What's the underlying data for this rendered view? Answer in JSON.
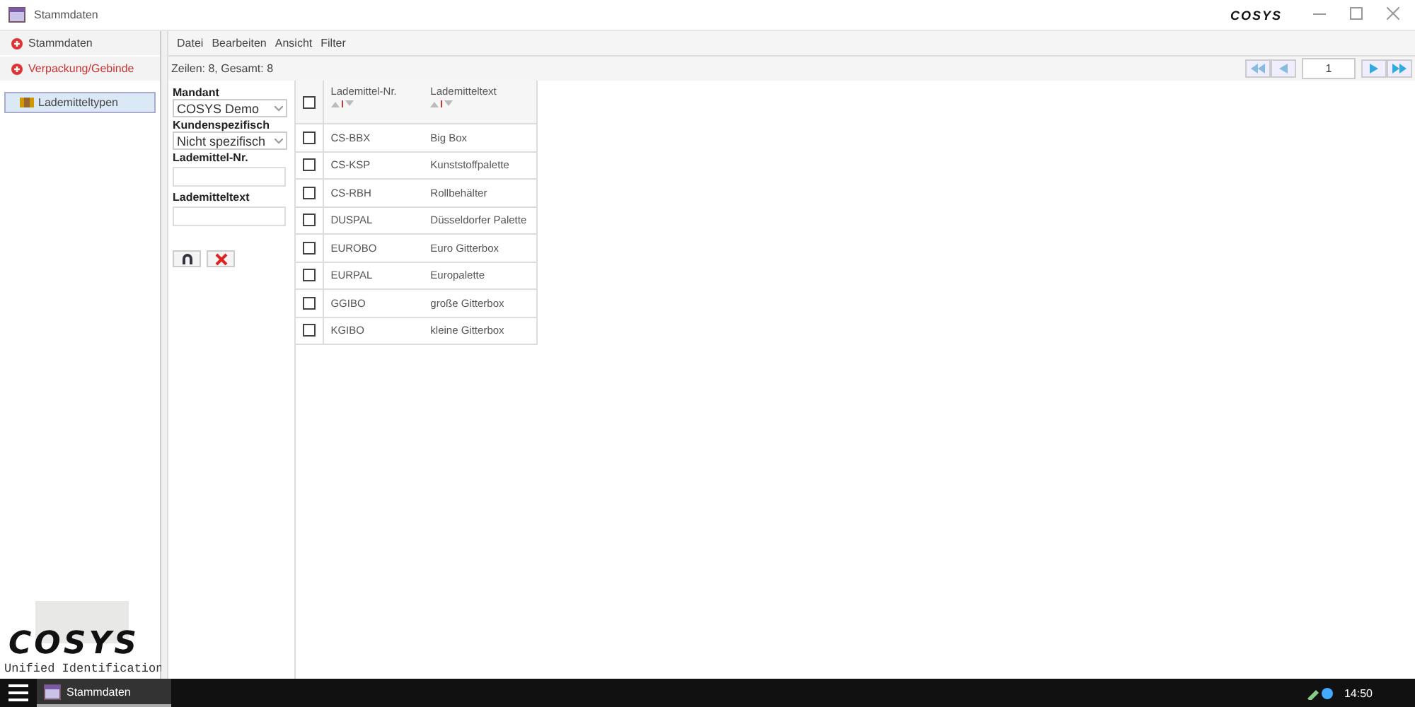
{
  "window": {
    "title": "Stammdaten",
    "logo": "COSYS"
  },
  "sidebar": {
    "items": [
      {
        "label": "Stammdaten",
        "selected": false
      },
      {
        "label": "Verpackung/Gebinde",
        "selected": true
      }
    ],
    "tree": [
      {
        "label": "Lademitteltypen",
        "selected": true
      }
    ],
    "brand": {
      "logo": "COSYS",
      "tagline": "Unified Identification"
    }
  },
  "menu": [
    "Datei",
    "Bearbeiten",
    "Ansicht",
    "Filter"
  ],
  "status": "Zeilen: 8, Gesamt: 8",
  "pager": {
    "page": "1"
  },
  "filters": [
    {
      "kind": "select",
      "label": "Mandant",
      "value": "COSYS Demo"
    },
    {
      "kind": "select",
      "label": "Kundenspezifisch",
      "value": "Nicht spezifisch"
    },
    {
      "kind": "input",
      "label": "Lademittel-Nr."
    },
    {
      "kind": "input",
      "label": "Lademitteltext"
    }
  ],
  "table": {
    "all_checked": false,
    "columns": [
      "Lademittel-Nr.",
      "Lademitteltext"
    ],
    "rows": [
      {
        "cells": [
          "CS-BBX",
          "Big Box"
        ],
        "checked": false
      },
      {
        "cells": [
          "CS-KSP",
          "Kunststoffpalette"
        ],
        "checked": false
      },
      {
        "cells": [
          "CS-RBH",
          "Rollbehälter"
        ],
        "checked": false
      },
      {
        "cells": [
          "DUSPAL",
          "Düsseldorfer Palette"
        ],
        "checked": false
      },
      {
        "cells": [
          "EUROBO",
          "Euro Gitterbox"
        ],
        "checked": false
      },
      {
        "cells": [
          "EURPAL",
          "Europalette"
        ],
        "checked": false
      },
      {
        "cells": [
          "GGIBO",
          "große Gitterbox"
        ],
        "checked": false
      },
      {
        "cells": [
          "KGIBO",
          "kleine Gitterbox"
        ],
        "checked": false
      }
    ]
  },
  "taskbar": {
    "app": "Stammdaten",
    "time": "14:50"
  }
}
